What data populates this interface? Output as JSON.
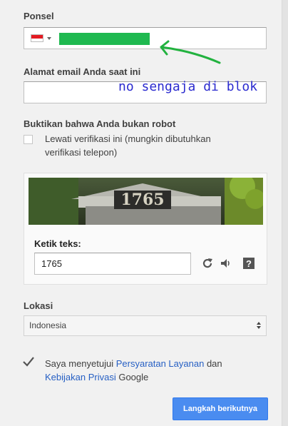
{
  "phone": {
    "label": "Ponsel",
    "flag_icon": "indonesia-flag-icon",
    "redaction_color": "#1fb950"
  },
  "annotation": {
    "text": "no sengaja di blok",
    "color": "#2b2bcf",
    "arrow_color": "#22b23f"
  },
  "email": {
    "label": "Alamat email Anda saat ini",
    "value": ""
  },
  "robot": {
    "label": "Buktikan bahwa Anda bukan robot",
    "skip_line1": "Lewati verifikasi ini (mungkin dibutuhkan",
    "skip_line2": "verifikasi telepon)"
  },
  "captcha": {
    "image_text": "1765",
    "label": "Ketik teks:",
    "value": "1765",
    "icons": [
      "refresh-icon",
      "audio-icon",
      "help-icon"
    ]
  },
  "location": {
    "label": "Lokasi",
    "selected": "Indonesia"
  },
  "terms": {
    "checked": true,
    "prefix": "Saya menyetujui ",
    "tos_link": "Persyaratan Layanan",
    "middle": " dan",
    "privacy_link": "Kebijakan Privasi",
    "suffix": " Google"
  },
  "next_button": {
    "label": "Langkah berikutnya",
    "color": "#4a8cf0"
  }
}
